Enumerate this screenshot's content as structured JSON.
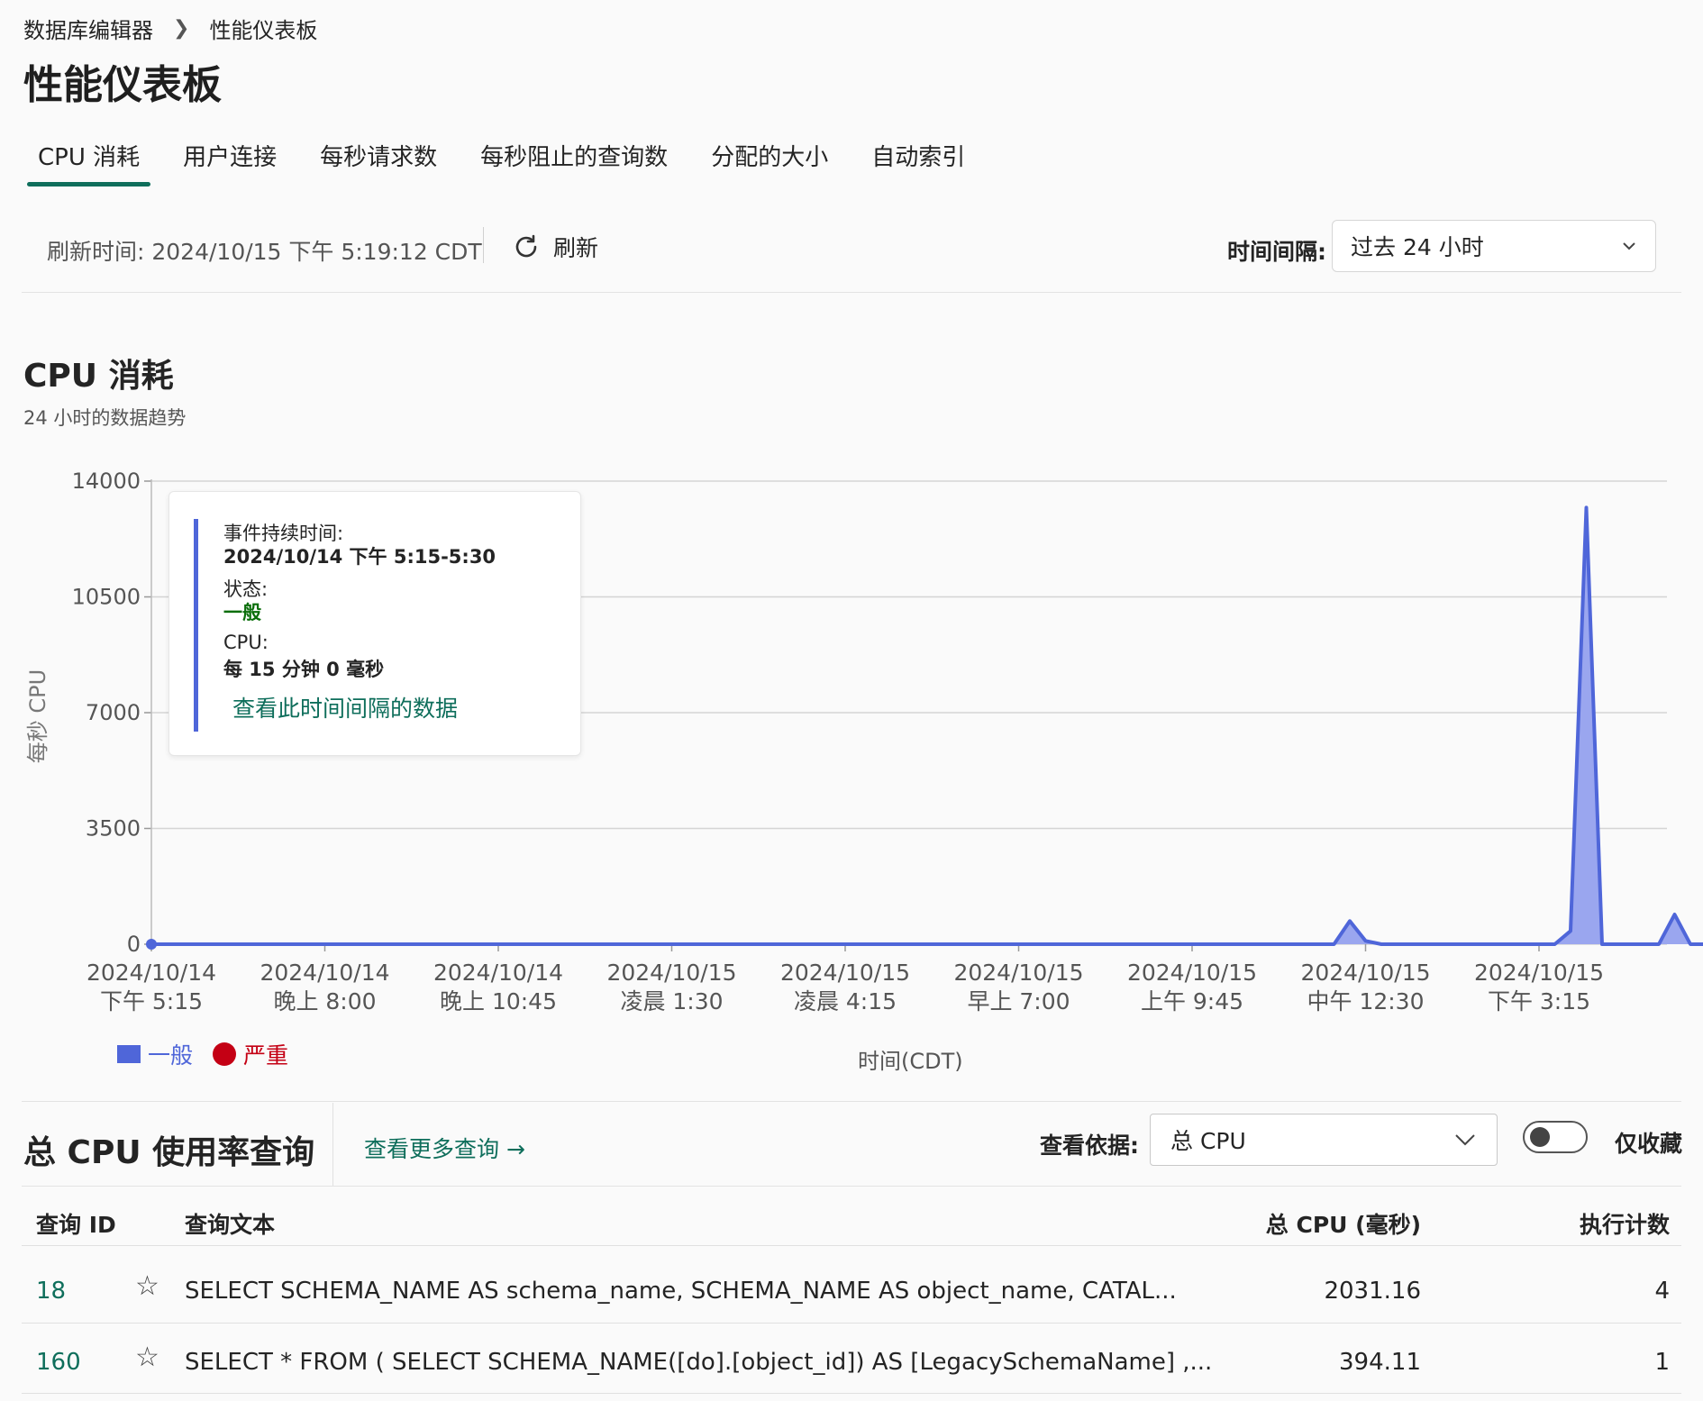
{
  "breadcrumb": {
    "parent": "数据库编辑器",
    "current": "性能仪表板"
  },
  "page_title": "性能仪表板",
  "tabs": [
    "CPU 消耗",
    "用户连接",
    "每秒请求数",
    "每秒阻止的查询数",
    "分配的大小",
    "自动索引"
  ],
  "active_tab": 0,
  "toolbar": {
    "refresh_time": "刷新时间: 2024/10/15 下午 5:19:12 CDT",
    "refresh_label": "刷新",
    "interval_label": "时间间隔:",
    "interval_value": "过去 24 小时"
  },
  "section": {
    "title": "CPU 消耗",
    "subtitle": "24 小时的数据趋势"
  },
  "tooltip": {
    "duration_label": "事件持续时间:",
    "duration_value": "2024/10/14 下午 5:15-5:30",
    "status_label": "状态:",
    "status_value": "一般",
    "cpu_label": "CPU:",
    "cpu_value": "每 15 分钟 0 毫秒",
    "link": "查看此时间间隔的数据"
  },
  "legend": {
    "normal": "一般",
    "severe": "严重"
  },
  "colors": {
    "accent": "#0e6e5b",
    "series_normal": "#4f66d9",
    "series_fill": "#9aa6ef",
    "severe": "#c40014"
  },
  "chart_data": {
    "type": "area",
    "ylabel": "每秒 CPU",
    "xlabel": "时间(CDT)",
    "ylim": [
      0,
      14000
    ],
    "yticks": [
      0,
      3500,
      7000,
      10500,
      14000
    ],
    "xticks": [
      [
        "2024/10/14",
        "下午 5:15"
      ],
      [
        "2024/10/14",
        "晚上 8:00"
      ],
      [
        "2024/10/14",
        "晚上 10:45"
      ],
      [
        "2024/10/15",
        "凌晨 1:30"
      ],
      [
        "2024/10/15",
        "凌晨 4:15"
      ],
      [
        "2024/10/15",
        "早上 7:00"
      ],
      [
        "2024/10/15",
        "上午 9:45"
      ],
      [
        "2024/10/15",
        "中午 12:30"
      ],
      [
        "2024/10/15",
        "下午 3:15"
      ]
    ],
    "grid": true,
    "x_unit": "hours since 2024/10/14 下午 5:15",
    "series": [
      {
        "name": "一般",
        "points": [
          [
            0,
            0
          ],
          [
            18.5,
            0
          ],
          [
            18.75,
            0
          ],
          [
            19.0,
            700
          ],
          [
            19.25,
            100
          ],
          [
            19.5,
            0
          ],
          [
            22.25,
            0
          ],
          [
            22.5,
            400
          ],
          [
            22.75,
            13200
          ],
          [
            23.0,
            0
          ],
          [
            23.75,
            0
          ],
          [
            23.9,
            0
          ],
          [
            24.15,
            900
          ],
          [
            24.4,
            0
          ],
          [
            24.6,
            0
          ]
        ]
      },
      {
        "name": "严重",
        "points": []
      }
    ]
  },
  "queries": {
    "title": "总 CPU 使用率查询",
    "more_link": "查看更多查询 →",
    "view_label": "查看依据:",
    "view_value": "总 CPU",
    "toggle_label": "仅收藏",
    "columns": [
      "查询 ID",
      "查询文本",
      "总 CPU (毫秒)",
      "执行计数"
    ],
    "rows": [
      {
        "id": "18",
        "text": "SELECT SCHEMA_NAME AS schema_name, SCHEMA_NAME AS object_name, CATAL...",
        "cpu": "2031.16",
        "count": "4"
      },
      {
        "id": "160",
        "text": "SELECT * FROM ( SELECT SCHEMA_NAME([do].[object_id]) AS [LegacySchemaName] ,...",
        "cpu": "394.11",
        "count": "1"
      }
    ]
  }
}
